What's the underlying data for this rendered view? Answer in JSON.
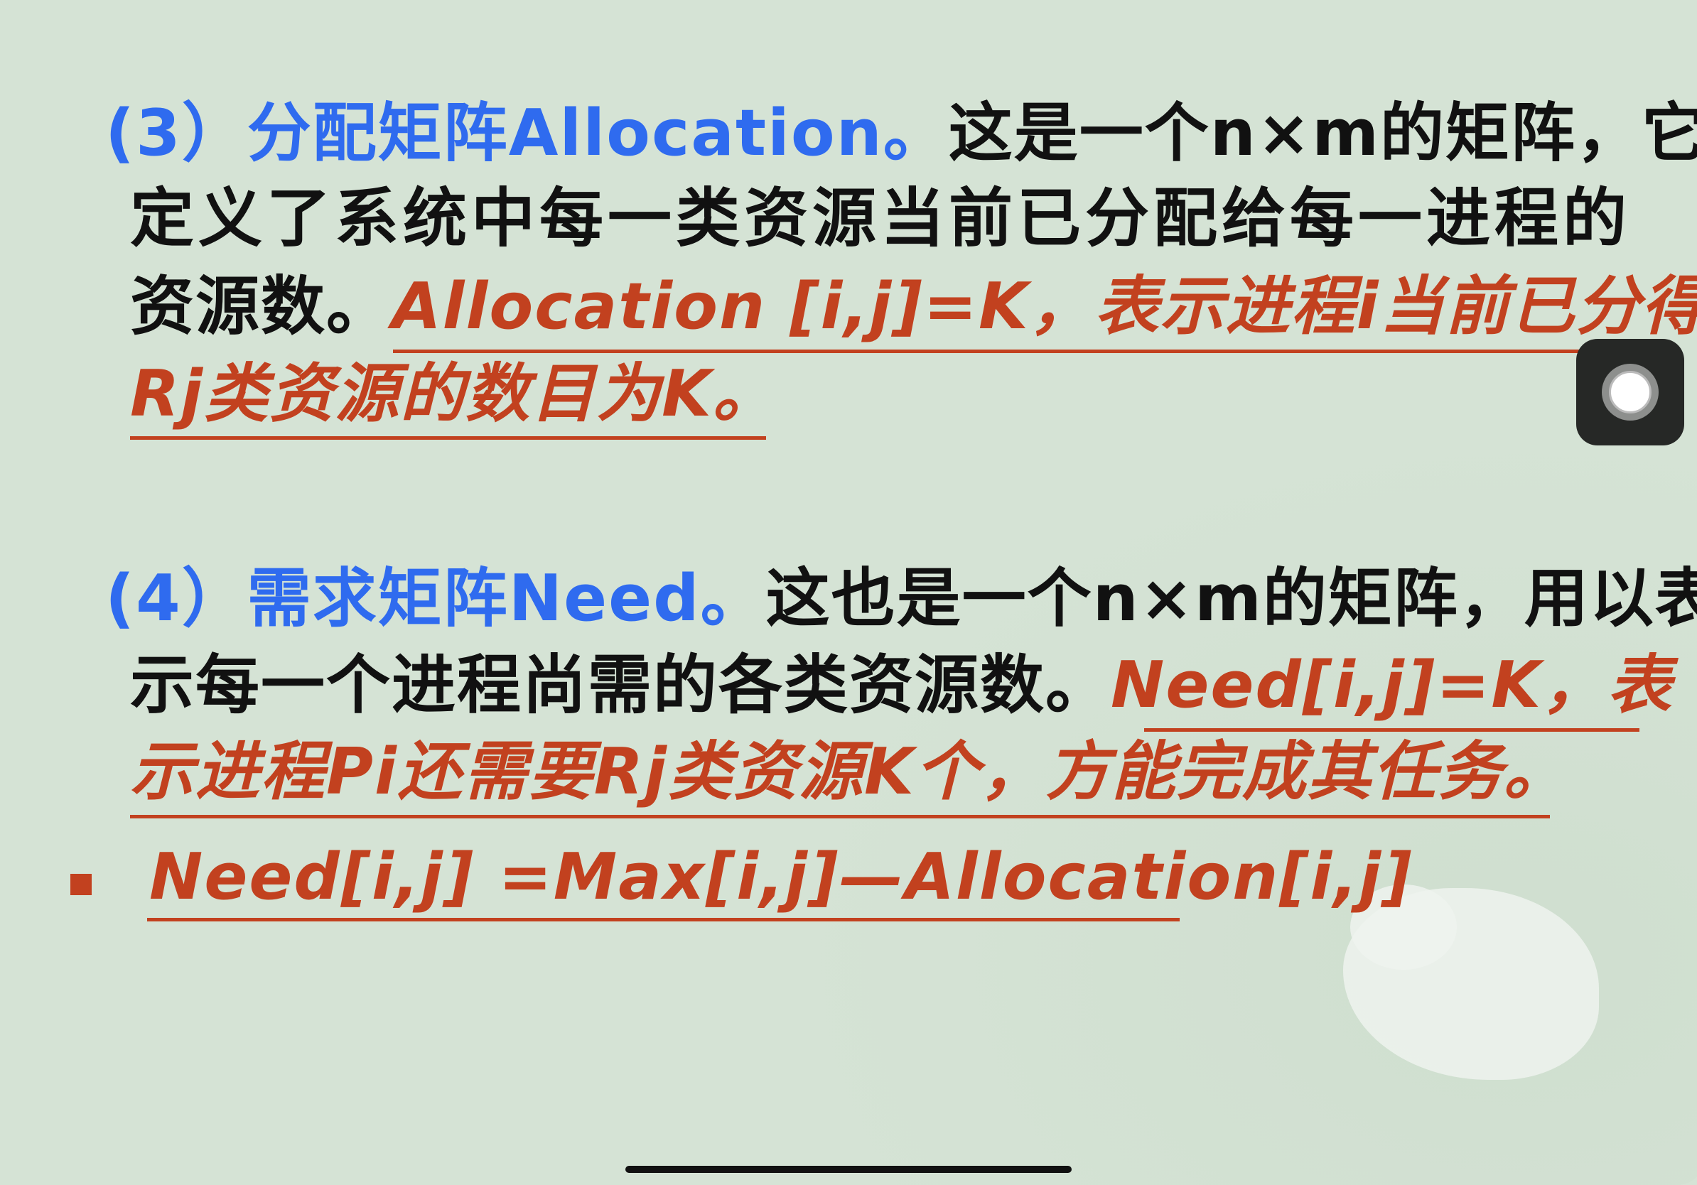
{
  "section3": {
    "heading": "(3）分配矩阵Allocation。",
    "line1_rest": "这是一个n×m的矩阵，它",
    "line2": "定义了系统中每一类资源当前已分配给每一进程的",
    "line3_plain": "资源数。",
    "line3_red": "Allocation  [i,j]=K，表示进程i当前已分得",
    "line4_red": "Rj类资源的数目为K。"
  },
  "section4": {
    "heading": "(4）需求矩阵Need。",
    "line1_rest": "这也是一个n×m的矩阵，用以表",
    "line2_plain": "示每一个进程尚需的各类资源数。",
    "line2_red": "Need[i,j]=K，表",
    "line3_red": "示进程Pi还需要Rj类资源K个，方能完成其任务。"
  },
  "formula": "Need[i,j] =Max[i,j]—Allocation[i,j]",
  "colors": {
    "background": "#d5e3d5",
    "heading": "#2f6bef",
    "emphasis": "#c2411f",
    "text": "#111111"
  },
  "icons": [
    "assistive-touch-icon",
    "bullet-square-icon"
  ]
}
